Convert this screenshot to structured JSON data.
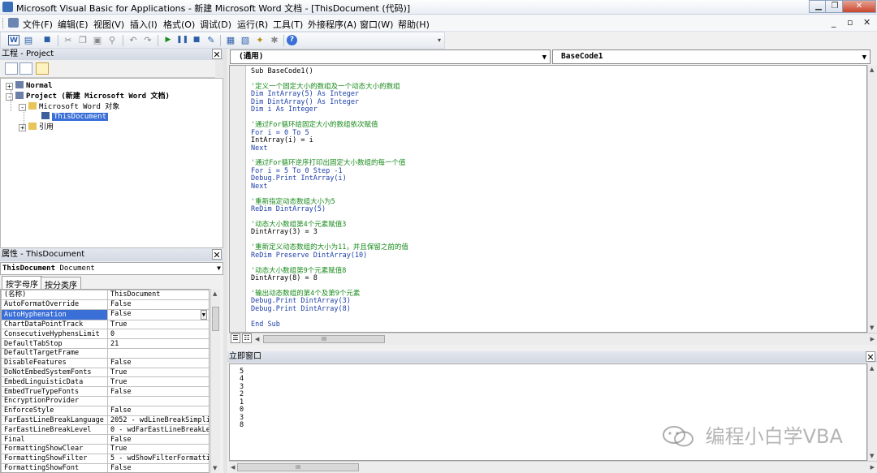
{
  "window": {
    "title": "Microsoft Visual Basic for Applications - 新建 Microsoft Word 文档 - [ThisDocument (代码)]",
    "min_label": "▁",
    "restore_label": "❐",
    "close_label": "✕"
  },
  "menu": {
    "items": [
      "文件(F)",
      "编辑(E)",
      "视图(V)",
      "插入(I)",
      "格式(O)",
      "调试(D)",
      "运行(R)",
      "工具(T)",
      "外接程序(A)",
      "窗口(W)",
      "帮助(H)"
    ],
    "mdi_min": "_",
    "mdi_restore": "▫",
    "mdi_close": "✕"
  },
  "toolbar": {
    "word_label": "W",
    "icons": [
      "view-word-icon",
      "insert-module-icon",
      "save-icon",
      "cut-icon",
      "copy-icon",
      "paste-icon",
      "find-icon",
      "undo-icon",
      "redo-icon",
      "run-icon",
      "break-icon",
      "reset-icon",
      "design-mode-icon",
      "project-explorer-icon",
      "properties-icon",
      "object-browser-icon",
      "toolbox-icon",
      "help-icon"
    ]
  },
  "project": {
    "title": "工程 - Project",
    "close_label": "✕",
    "tree": [
      {
        "label": "Normal",
        "toggle": "+",
        "bold": true
      },
      {
        "label": "Project (新建 Microsoft Word 文档)",
        "toggle": "-",
        "bold": true
      },
      {
        "label": "Microsoft Word 对象",
        "toggle": "-"
      },
      {
        "label": "ThisDocument",
        "selected": true
      },
      {
        "label": "引用",
        "toggle": "+"
      }
    ]
  },
  "properties": {
    "title": "属性 - ThisDocument",
    "close_label": "✕",
    "object_name": "ThisDocument",
    "object_type": "Document",
    "tabs": [
      "按字母序",
      "按分类序"
    ],
    "rows": [
      [
        "(名称)",
        "ThisDocument"
      ],
      [
        "AutoFormatOverride",
        "False"
      ],
      [
        "AutoHyphenation",
        "False"
      ],
      [
        "ChartDataPointTrack",
        "True"
      ],
      [
        "ConsecutiveHyphensLimit",
        "0"
      ],
      [
        "DefaultTabStop",
        "21"
      ],
      [
        "DefaultTargetFrame",
        ""
      ],
      [
        "DisableFeatures",
        "False"
      ],
      [
        "DoNotEmbedSystemFonts",
        "True"
      ],
      [
        "EmbedLinguisticData",
        "True"
      ],
      [
        "EmbedTrueTypeFonts",
        "False"
      ],
      [
        "EncryptionProvider",
        ""
      ],
      [
        "EnforceStyle",
        "False"
      ],
      [
        "FarEastLineBreakLanguage",
        "2052 - wdLineBreakSimplifi"
      ],
      [
        "FarEastLineBreakLevel",
        "0 - wdFarEastLineBreakLeve"
      ],
      [
        "Final",
        "False"
      ],
      [
        "FormattingShowClear",
        "True"
      ],
      [
        "FormattingShowFilter",
        "5 - wdShowFilterFormatting"
      ],
      [
        "FormattingShowFont",
        "False"
      ]
    ]
  },
  "code": {
    "object_combo": "(通用)",
    "proc_combo": "BaseCode1",
    "lines": [
      {
        "t": "Sub BaseCode1()",
        "k": "code"
      },
      {
        "t": "",
        "k": "code"
      },
      {
        "t": "'定义一个固定大小的数组及一个动态大小的数组",
        "k": "cm"
      },
      {
        "t": "Dim IntArray(5) As Integer",
        "k": "kw"
      },
      {
        "t": "Dim DintArray() As Integer",
        "k": "kw"
      },
      {
        "t": "Dim i As Integer",
        "k": "kw"
      },
      {
        "t": "",
        "k": "code"
      },
      {
        "t": "'通过For循环给固定大小的数组依次赋值",
        "k": "cm"
      },
      {
        "t": "For i = 0 To 5",
        "k": "kw"
      },
      {
        "t": "IntArray(i) = i",
        "k": "code"
      },
      {
        "t": "Next",
        "k": "kw"
      },
      {
        "t": "",
        "k": "code"
      },
      {
        "t": "'通过For循环逆序打印出固定大小数组的每一个值",
        "k": "cm"
      },
      {
        "t": "For i = 5 To 0 Step -1",
        "k": "kw"
      },
      {
        "t": "Debug.Print IntArray(i)",
        "k": "kw"
      },
      {
        "t": "Next",
        "k": "kw"
      },
      {
        "t": "",
        "k": "code"
      },
      {
        "t": "'重新指定动态数组大小为5",
        "k": "cm"
      },
      {
        "t": "ReDim DintArray(5)",
        "k": "kw"
      },
      {
        "t": "",
        "k": "code"
      },
      {
        "t": "'动态大小数组第4个元素赋值3",
        "k": "cm"
      },
      {
        "t": "DintArray(3) = 3",
        "k": "code"
      },
      {
        "t": "",
        "k": "code"
      },
      {
        "t": "'重新定义动态数组的大小为11，并且保留之前的值",
        "k": "cm"
      },
      {
        "t": "ReDim Preserve DintArray(10)",
        "k": "kw"
      },
      {
        "t": "",
        "k": "code"
      },
      {
        "t": "'动态大小数组第9个元素赋值8",
        "k": "cm"
      },
      {
        "t": "DintArray(8) = 8",
        "k": "code"
      },
      {
        "t": "",
        "k": "code"
      },
      {
        "t": "'输出动态数组的第4个及第9个元素",
        "k": "cm"
      },
      {
        "t": "Debug.Print DintArray(3)",
        "k": "kw"
      },
      {
        "t": "Debug.Print DintArray(8)",
        "k": "kw"
      },
      {
        "t": "",
        "k": "code"
      },
      {
        "t": "End Sub",
        "k": "kw"
      }
    ],
    "hscroll_thumb": "III"
  },
  "immediate": {
    "title": "立即窗口",
    "close_label": "✕",
    "output": [
      "5",
      "4",
      "3",
      "2",
      "1",
      "0",
      "3",
      "8"
    ],
    "hscroll_thumb": "III"
  },
  "watermark": {
    "text": "编程小白学VBA"
  },
  "colors": {
    "keyword": "#1c3fa8",
    "comment": "#178a1a",
    "selection": "#3a6fd8"
  }
}
